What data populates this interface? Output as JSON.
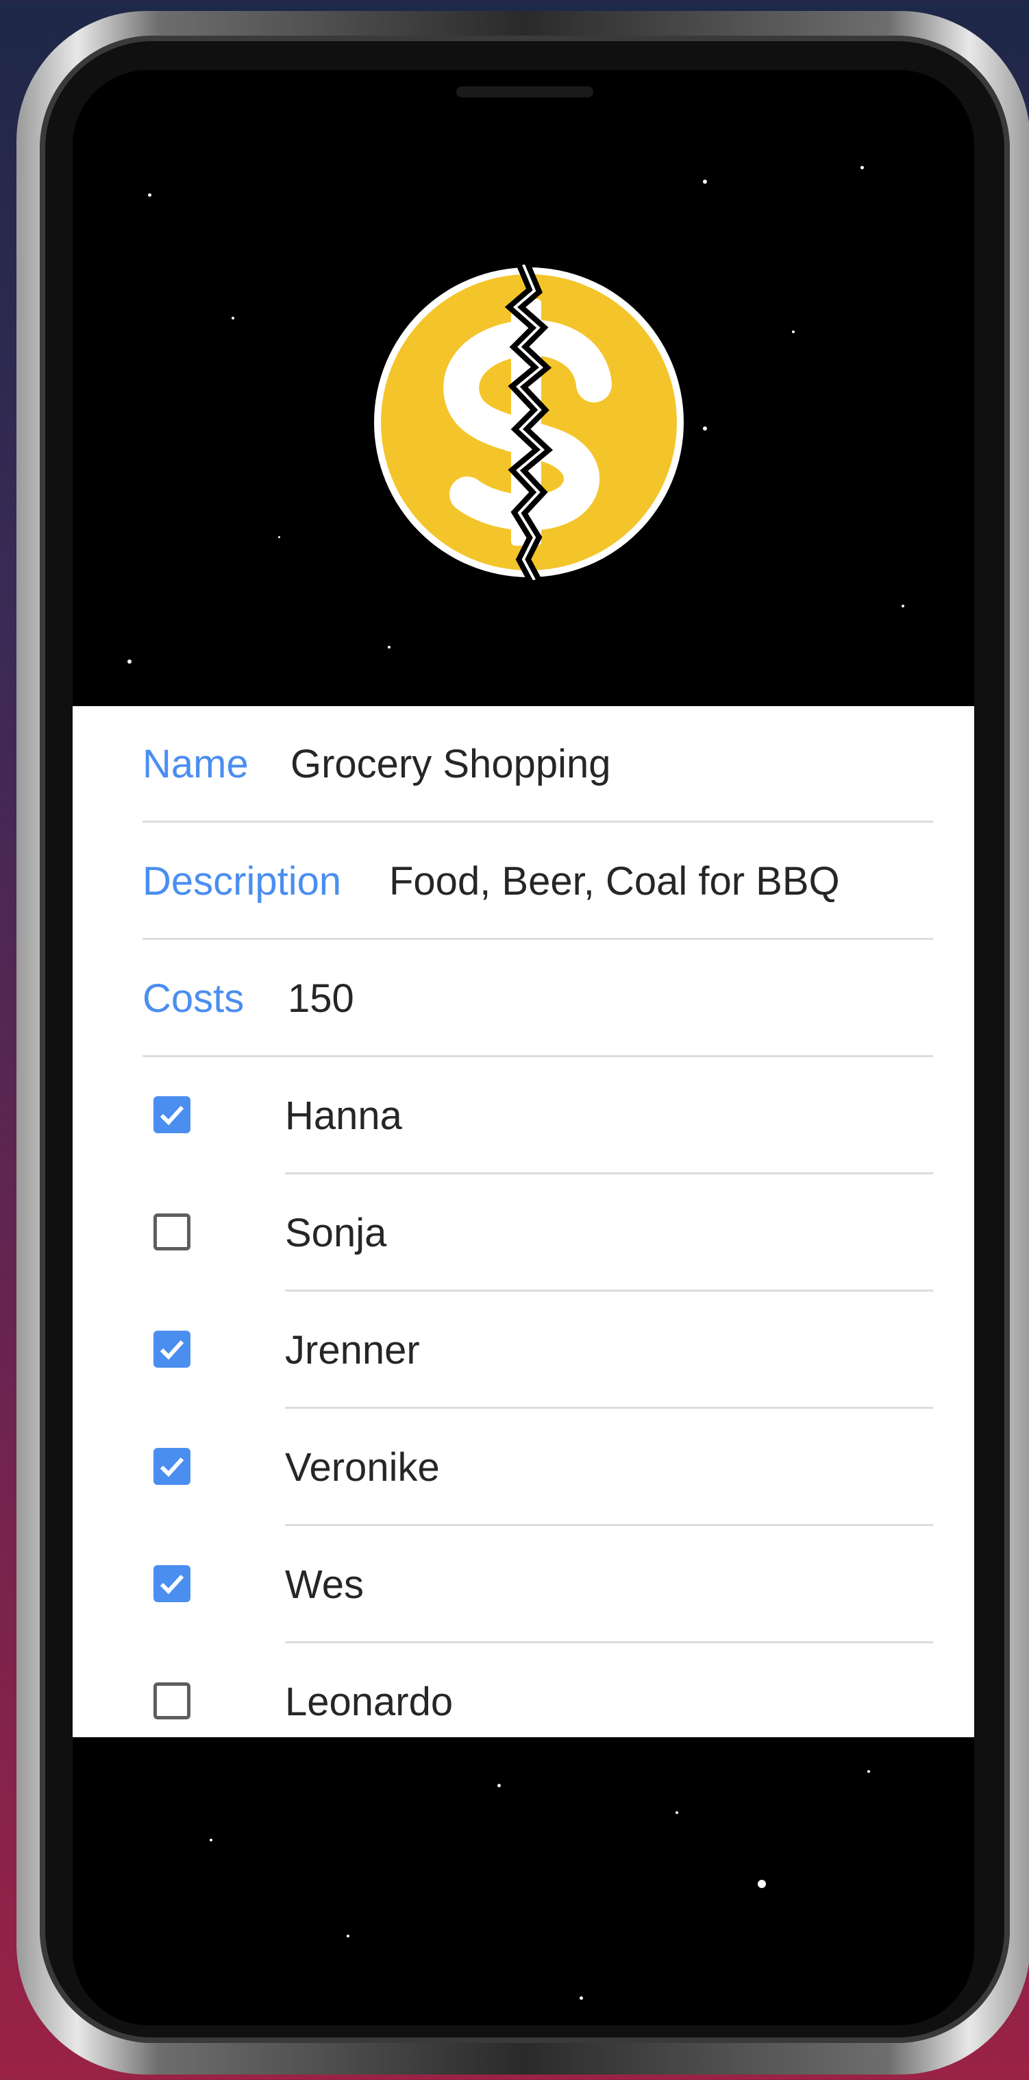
{
  "form": {
    "name": {
      "label": "Name",
      "value": "Grocery Shopping"
    },
    "description": {
      "label": "Description",
      "value": "Food, Beer, Coal for BBQ"
    },
    "costs": {
      "label": "Costs",
      "value": "150"
    }
  },
  "participants": [
    {
      "name": "Hanna",
      "checked": true
    },
    {
      "name": "Sonja",
      "checked": false
    },
    {
      "name": "Jrenner",
      "checked": true
    },
    {
      "name": "Veronike",
      "checked": true
    },
    {
      "name": "Wes",
      "checked": true
    },
    {
      "name": "Leonardo",
      "checked": false
    }
  ],
  "colors": {
    "accent": "#4a8ef0",
    "coin": "#f4c52b",
    "text": "#262626",
    "divider": "#dcdcdc"
  },
  "icons": {
    "logo": "cracked-dollar-coin-icon",
    "checked": "checkbox-checked-icon",
    "unchecked": "checkbox-unchecked-icon"
  }
}
